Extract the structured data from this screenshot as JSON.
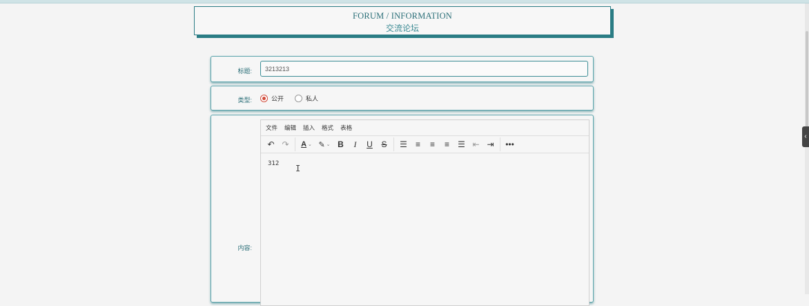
{
  "header": {
    "title_en": "FORUM / INFORMATION",
    "title_cn": "交流论坛"
  },
  "form": {
    "title_label": "标题:",
    "title_value": "3213213",
    "type_label": "类型:",
    "type_options": [
      "公开",
      "私人"
    ],
    "type_selected": "公开",
    "content_label": "内容:"
  },
  "editor": {
    "menu": [
      "文件",
      "编辑",
      "插入",
      "格式",
      "表格"
    ],
    "content": "312",
    "toolbar_icons": [
      "undo-icon",
      "redo-icon",
      "font-color-icon",
      "highlight-icon",
      "bold-icon",
      "italic-icon",
      "underline-icon",
      "strikethrough-icon",
      "line-height-icon",
      "align-left-icon",
      "align-center-icon",
      "align-right-icon",
      "align-justify-icon",
      "outdent-icon",
      "indent-icon",
      "more-icon"
    ]
  },
  "colors": {
    "accent": "#2a7c84",
    "radio_checked": "#d14b3a",
    "background": "#f4f4f4"
  }
}
